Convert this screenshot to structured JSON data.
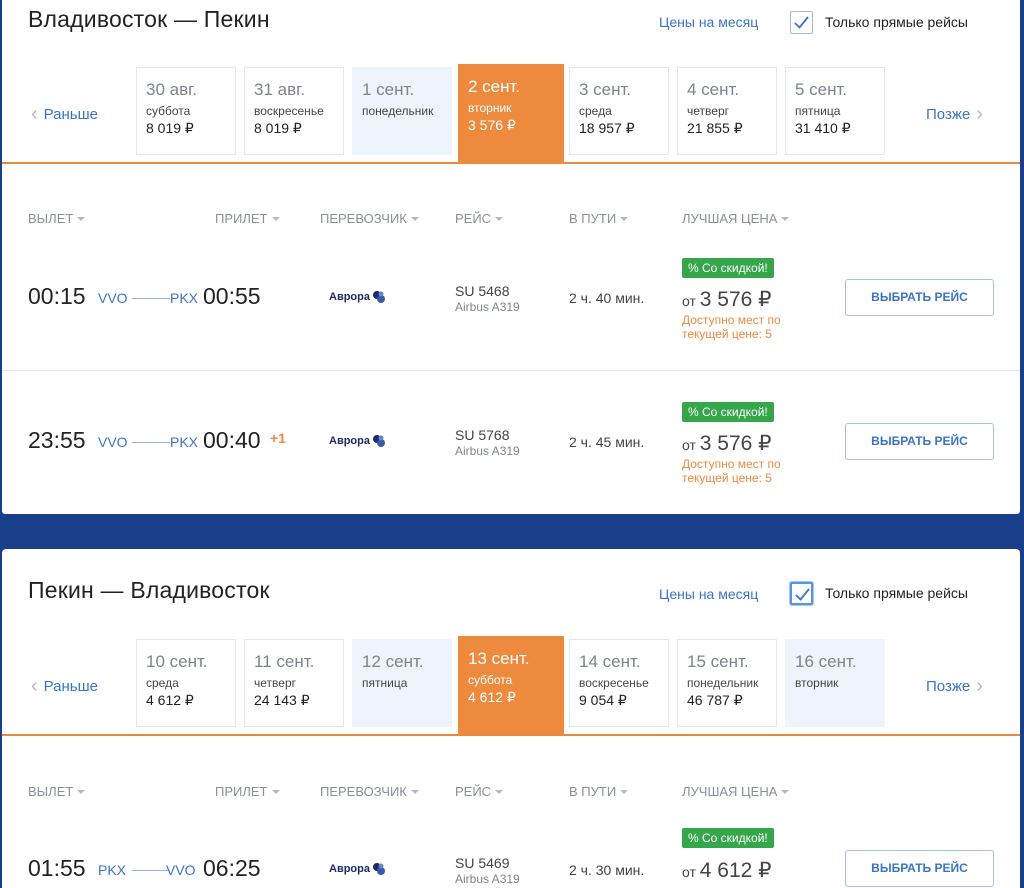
{
  "colors": {
    "accent": "#ee8a3e",
    "link": "#3a74c8",
    "discount": "#35a64a",
    "background": "#1a3f8a"
  },
  "legs": [
    {
      "title": "Владивосток — Пекин",
      "month_link": "Цены на месяц",
      "direct_label": "Только прямые рейсы",
      "direct_checked": true,
      "prev_label": "Раньше",
      "next_label": "Позже",
      "dates": [
        {
          "date": "30 авг.",
          "day": "суббота",
          "price": "8 019 ₽"
        },
        {
          "date": "31 авг.",
          "day": "воскресенье",
          "price": "8 019 ₽"
        },
        {
          "date": "1 сент.",
          "day": "понедельник",
          "price": ""
        },
        {
          "date": "2 сент.",
          "day": "вторник",
          "price": "3 576 ₽",
          "selected": true
        },
        {
          "date": "3 сент.",
          "day": "среда",
          "price": "18 957 ₽"
        },
        {
          "date": "4 сент.",
          "day": "четверг",
          "price": "21 855 ₽"
        },
        {
          "date": "5 сент.",
          "day": "пятница",
          "price": "31 410 ₽"
        }
      ],
      "columns": [
        "ВЫЛЕТ",
        "ПРИЛЕТ",
        "ПЕРЕВОЗЧИК",
        "РЕЙС",
        "В ПУТИ",
        "ЛУЧШАЯ ЦЕНА"
      ],
      "flights": [
        {
          "dep_time": "00:15",
          "dep_code": "VVO",
          "arr_code": "PKX",
          "arr_time": "00:55",
          "plus_day": "",
          "carrier": "Аврора",
          "flight_no": "SU 5468",
          "aircraft": "Airbus A319",
          "duration": "2 ч. 40 мин.",
          "discount": "% Со скидкой!",
          "price_prefix": "от",
          "price": "3 576 ₽",
          "seats_line1": "Доступно мест по",
          "seats_line2": "текущей цене: 5",
          "button": "ВЫБРАТЬ РЕЙС"
        },
        {
          "dep_time": "23:55",
          "dep_code": "VVO",
          "arr_code": "PKX",
          "arr_time": "00:40",
          "plus_day": "+1",
          "carrier": "Аврора",
          "flight_no": "SU 5768",
          "aircraft": "Airbus A319",
          "duration": "2 ч. 45 мин.",
          "discount": "% Со скидкой!",
          "price_prefix": "от",
          "price": "3 576 ₽",
          "seats_line1": "Доступно мест по",
          "seats_line2": "текущей цене: 5",
          "button": "ВЫБРАТЬ РЕЙС"
        }
      ]
    },
    {
      "title": "Пекин — Владивосток",
      "month_link": "Цены на месяц",
      "direct_label": "Только прямые рейсы",
      "direct_checked": true,
      "prev_label": "Раньше",
      "next_label": "Позже",
      "dates": [
        {
          "date": "10 сент.",
          "day": "среда",
          "price": "4 612 ₽"
        },
        {
          "date": "11 сент.",
          "day": "четверг",
          "price": "24 143 ₽"
        },
        {
          "date": "12 сент.",
          "day": "пятница",
          "price": ""
        },
        {
          "date": "13 сент.",
          "day": "суббота",
          "price": "4 612 ₽",
          "selected": true
        },
        {
          "date": "14 сент.",
          "day": "воскресенье",
          "price": "9 054 ₽"
        },
        {
          "date": "15 сент.",
          "day": "понедельник",
          "price": "46 787 ₽"
        },
        {
          "date": "16 сент.",
          "day": "вторник",
          "price": ""
        }
      ],
      "columns": [
        "ВЫЛЕТ",
        "ПРИЛЕТ",
        "ПЕРЕВОЗЧИК",
        "РЕЙС",
        "В ПУТИ",
        "ЛУЧШАЯ ЦЕНА"
      ],
      "flights": [
        {
          "dep_time": "01:55",
          "dep_code": "PKX",
          "arr_code": "VVO",
          "arr_time": "06:25",
          "plus_day": "",
          "carrier": "Аврора",
          "flight_no": "SU 5469",
          "aircraft": "Airbus A319",
          "duration": "2 ч. 30 мин.",
          "discount": "% Со скидкой!",
          "price_prefix": "от",
          "price": "4 612 ₽",
          "seats_line1": "",
          "seats_line2": "",
          "button": "ВЫБРАТЬ РЕЙС"
        }
      ]
    }
  ]
}
